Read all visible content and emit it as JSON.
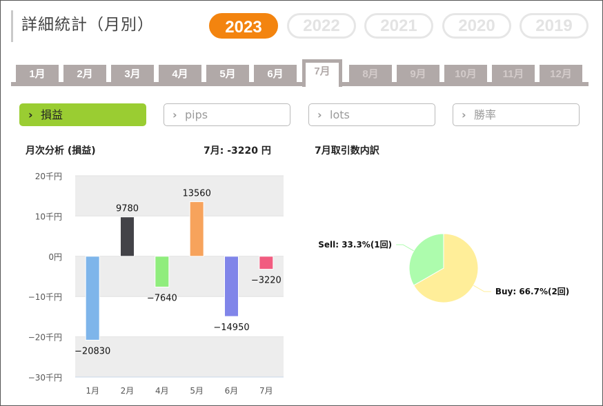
{
  "title": "詳細統計（月別）",
  "years": [
    "2023",
    "2022",
    "2021",
    "2020",
    "2019"
  ],
  "active_year": "2023",
  "months": [
    "1月",
    "2月",
    "3月",
    "4月",
    "5月",
    "6月",
    "7月",
    "8月",
    "9月",
    "10月",
    "11月",
    "12月"
  ],
  "active_month": "7月",
  "metrics": [
    {
      "label": "損益",
      "active": true
    },
    {
      "label": "pips",
      "active": false
    },
    {
      "label": "lots",
      "active": false
    },
    {
      "label": "勝率",
      "active": false
    }
  ],
  "monthly_analysis": {
    "title": "月次分析 (損益)",
    "summary": "7月:  -3220 円"
  },
  "breakdown": {
    "title": "7月取引数内訳"
  },
  "chart_data": [
    {
      "type": "bar",
      "categories": [
        "1月",
        "2月",
        "4月",
        "5月",
        "6月",
        "7月"
      ],
      "values": [
        -20830,
        9780,
        -7640,
        13560,
        -14950,
        -3220
      ],
      "value_labels": [
        "−20830",
        "9780",
        "−7640",
        "13560",
        "−14950",
        "−3220"
      ],
      "colors": [
        "#7eb5ea",
        "#434348",
        "#90ed7d",
        "#f7a35c",
        "#8085e9",
        "#f15c80"
      ],
      "ylim": [
        -30000,
        20000
      ],
      "yticks": [
        {
          "value": 20000,
          "label": "20千円"
        },
        {
          "value": 10000,
          "label": "10千円"
        },
        {
          "value": 0,
          "label": "0円"
        },
        {
          "value": -10000,
          "label": "−10千円"
        },
        {
          "value": -20000,
          "label": "−20千円"
        },
        {
          "value": -30000,
          "label": "−30千円"
        }
      ],
      "grid": "alternating bands"
    },
    {
      "type": "pie",
      "slices": [
        {
          "label": "Buy: 66.7%(2回)",
          "value": 66.7,
          "color": "#ffee99"
        },
        {
          "label": "Sell: 33.3%(1回)",
          "value": 33.3,
          "color": "#adfcad"
        }
      ]
    }
  ]
}
